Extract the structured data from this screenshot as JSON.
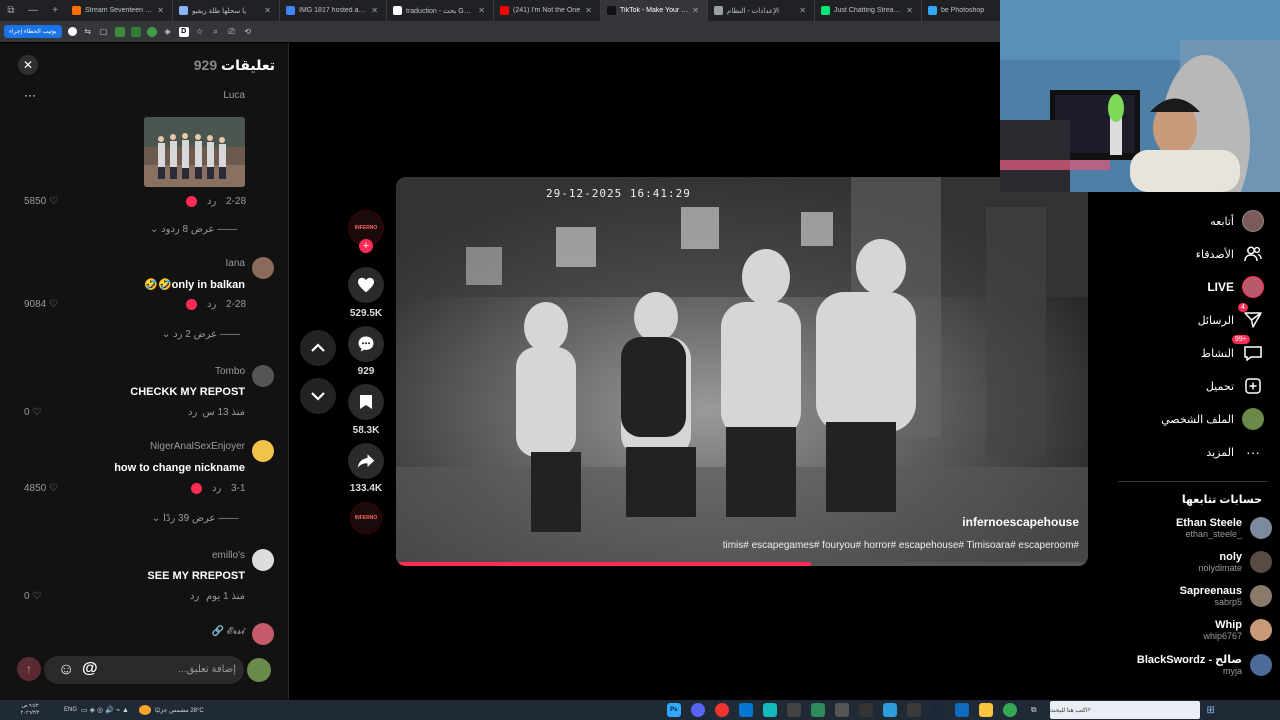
{
  "browser": {
    "tabs": [
      {
        "title": "Stream Seventeen Beats",
        "fav": "#ff6d00",
        "active": false
      },
      {
        "title": "يا سحلها طلة ريفيو",
        "fav": "#8ab4f8",
        "active": false
      },
      {
        "title": "IMG 1817 hosted at ImgBB",
        "fav": "#4285f4",
        "active": false
      },
      {
        "title": "traduction - بحث Google",
        "fav": "#ffffff",
        "active": false
      },
      {
        "title": "(241) I'm Not the One",
        "fav": "#ff0000",
        "active": false
      },
      {
        "title": "TikTok - Make Your Day",
        "fav": "#111111",
        "active": true
      },
      {
        "title": "الإعدادات - النظام",
        "fav": "#9aa0a6",
        "active": false
      },
      {
        "title": "Just Chatting Streaming",
        "fav": "#00e676",
        "active": false
      },
      {
        "title": "be Photoshop",
        "fav": "#31a8ff",
        "active": false
      }
    ],
    "toolbar_btn": "يوتيب الحظاء إجراء"
  },
  "comments_panel": {
    "title_word": "تعليقات",
    "count": "929",
    "close_icon": "close-icon",
    "menu_dots": "···",
    "items": [
      {
        "author": "Luca",
        "has_image": true,
        "date": "2-28",
        "reply": "رد",
        "likes": "5850",
        "view_replies": "عرض 8 ردود"
      },
      {
        "author": "Iana",
        "text": "🤣🤣only in balkan",
        "date": "2-28",
        "reply": "رد",
        "likes": "9084",
        "view_replies": "عرض 2 رد"
      },
      {
        "author": "Tombo",
        "text": "CHECKK MY REPOST",
        "date": "منذ 13 س",
        "reply": "رد",
        "likes": "0"
      },
      {
        "author": "NigerAnalSexEnjoyer",
        "text": "how to change nickname",
        "date": "3-1",
        "reply": "رد",
        "likes": "4850",
        "view_replies": "عرض 39 ردًا"
      },
      {
        "author": "emillo's",
        "text": "SEE MY RREPOST",
        "date": "منذ 1 يوم",
        "reply": "رد",
        "likes": "0"
      },
      {
        "author": "🔗 𝓔𝓻𝓼𝓲"
      }
    ],
    "input_placeholder": "إضافة تعليق...",
    "at": "@"
  },
  "video": {
    "timestamp": "29-12-2025 16:41:29",
    "username": "infernoescapehouse",
    "hashtags": "timis# escapegames# fouryou# horror# escapehouse# Timisoara# escaperoom#",
    "progress": 0.6,
    "actions": {
      "likes": "529.5K",
      "comments": "929",
      "saves": "58.3K",
      "shares": "133.4K"
    },
    "creator_avatar_text": "INFERNO"
  },
  "sidebar": {
    "items": [
      {
        "label": "أتابعه",
        "icon": "avatar-icon"
      },
      {
        "label": "الأصدقاء",
        "icon": "friends-icon"
      },
      {
        "label": "LIVE",
        "icon": "live-icon"
      },
      {
        "label": "الرسائل",
        "icon": "send-icon",
        "badge": "4"
      },
      {
        "label": "النشاط",
        "icon": "inbox-icon",
        "badge": "+99"
      },
      {
        "label": "تحميل",
        "icon": "upload-icon"
      },
      {
        "label": "الملف الشخصي",
        "icon": "profile-icon"
      },
      {
        "label": "المزيد",
        "icon": "more-icon"
      }
    ],
    "following_title": "حسابات تتابعها",
    "accounts": [
      {
        "name": "Ethan Steele",
        "handle": "ethan_steele_",
        "color": "#7b8a9c"
      },
      {
        "name": "noly",
        "handle": "nolydimate",
        "color": "#5a4a44"
      },
      {
        "name": "Sapreenaus",
        "handle": "sabrp5",
        "color": "#8a7a6a"
      },
      {
        "name": "Whip",
        "handle": "whip6767",
        "color": "#c99a7a"
      },
      {
        "name": "BlackSwordz - صالح",
        "handle": "myja",
        "color": "#4c6a9a"
      }
    ]
  },
  "taskbar": {
    "weather": "28°C مشمس جزئيًا",
    "search": "اكتب هنا للبحث",
    "lang": "ENG",
    "time": "٩:٥٣ ص",
    "date": "٢٠٢٦/٣/٢"
  }
}
